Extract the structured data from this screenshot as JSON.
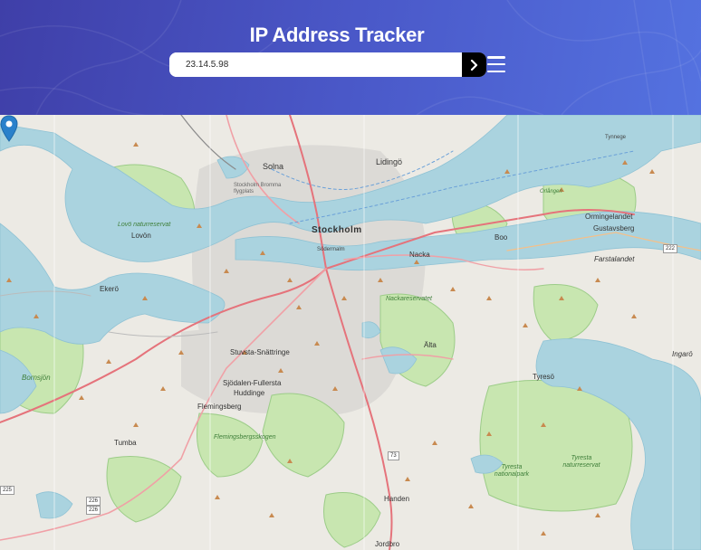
{
  "header": {
    "title": "IP Address Tracker",
    "search_value": "23.14.5.98"
  },
  "icons": {
    "submit": "chevron-right-icon",
    "menu": "hamburger-menu-icon",
    "marker": "location-pin-icon"
  },
  "colors": {
    "header_start": "#3f3fa8",
    "header_end": "#5472e0",
    "button": "#000000",
    "marker": "#2a81cb",
    "water": "#aad3df",
    "park": "#c8e6b0"
  },
  "map": {
    "labels": {
      "stockholm": "Stockholm",
      "solna": "Solna",
      "lidingo": "Lidingö",
      "lovon": "Lovön",
      "lovo_naturreservat": "Lovö naturreservat",
      "ekero": "Ekerö",
      "boo": "Boo",
      "nacka": "Nacka",
      "orminge": "Ormingelandet",
      "gustavsberg": "Gustavsberg",
      "farstalandet": "Farstalandet",
      "tynnege": "Tynnege",
      "sodermalm": "Södermalm",
      "nackareservatet": "Nackareservatet",
      "alta": "Älta",
      "stuvsta": "Stuvsta-Snättringe",
      "sjodalen": "Sjödalen-Fullersta",
      "huddinge": "Huddinge",
      "flemingsberg": "Flemingsberg",
      "flemingsbergsskogen": "Flemingsbergsskogen",
      "tumba": "Tumba",
      "bornsjon": "Bornsjön",
      "tyreso": "Tyresö",
      "tyresta": "Tyresta nationalpark",
      "tyresta_reservat": "Tyresta naturreservat",
      "handen": "Handen",
      "jordbro": "Jordbro",
      "ingaro": "Ingarö",
      "orlangen": "Orlången",
      "bromma": "Stockholm Bromma flygplats"
    },
    "roads": [
      "225",
      "226",
      "73",
      "222",
      "226"
    ]
  }
}
